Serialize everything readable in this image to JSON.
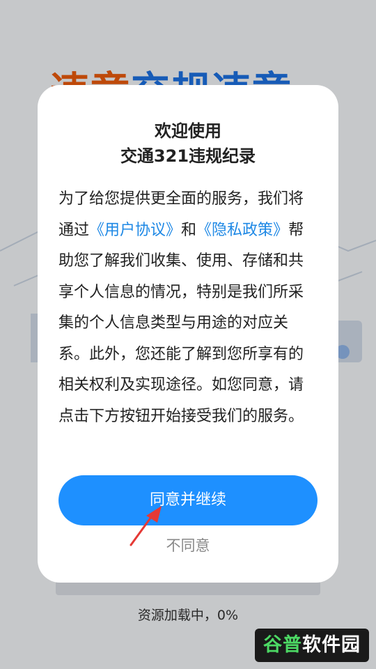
{
  "splash": {
    "title_part_a": "违章",
    "title_part_b": "交规违章",
    "loading_text": "资源加载中，0%",
    "progress_fraction": 0.0
  },
  "dialog": {
    "title_line1": "欢迎使用",
    "title_line2": "交通321违规纪录",
    "body": {
      "text1": "为了给您提供更全面的服务，我们将通过",
      "link_user_agreement": "《用户协议》",
      "text2": "和",
      "link_privacy_policy": "《隐私政策》",
      "text3": "帮助您了解我们收集、使用、存储和共享个人信息的情况，特别是我们所采集的个人信息类型与用途的对应关系。此外，您还能了解到您所享有的相关权利及实现途径。如您同意，请点击下方按钮开始接受我们的服务。"
    },
    "agree_button": "同意并继续",
    "disagree_button": "不同意"
  },
  "watermark": {
    "part_a": "谷普",
    "part_b": "软件园"
  },
  "colors": {
    "accent": "#1e90ff",
    "link": "#1e88e5",
    "arrow": "#e53935"
  }
}
